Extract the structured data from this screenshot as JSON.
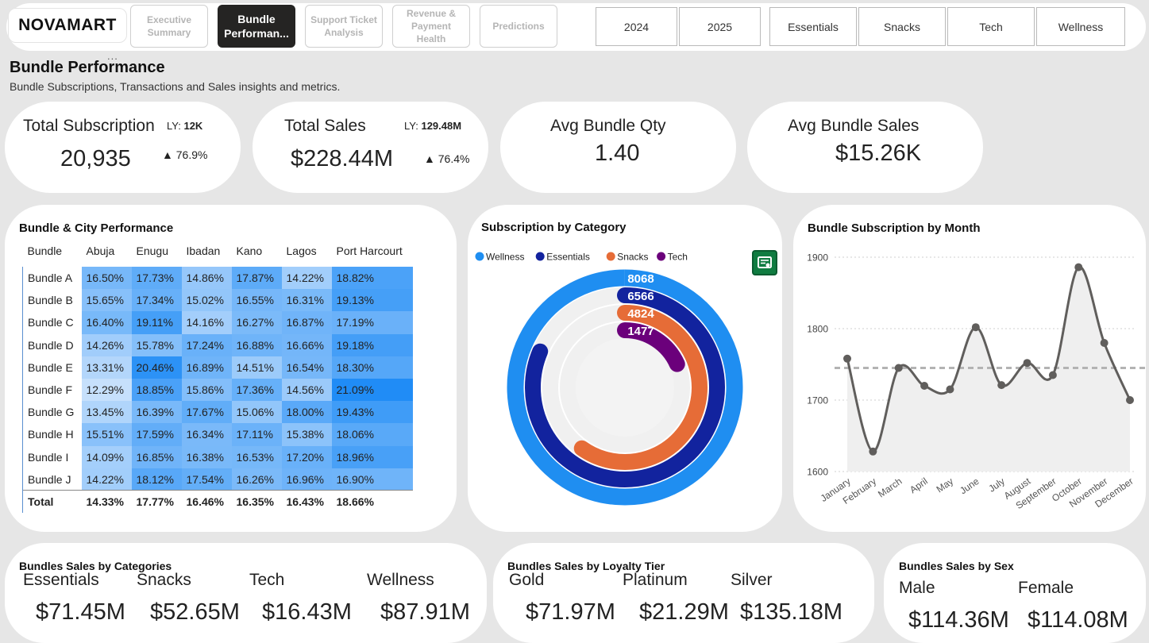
{
  "brand": "NOVAMART",
  "nav": [
    {
      "label": "Executive Summary",
      "active": false
    },
    {
      "label": "Bundle Performan...",
      "active": true
    },
    {
      "label": "Support Ticket Analysis",
      "active": false
    },
    {
      "label": "Revenue & Payment Health",
      "active": false
    },
    {
      "label": "Predictions",
      "active": false
    }
  ],
  "filters": {
    "years": [
      "2024",
      "2025"
    ],
    "categories": [
      "Essentials",
      "Snacks",
      "Tech",
      "Wellness"
    ]
  },
  "page": {
    "more": "...",
    "title": "Bundle Performance",
    "subtitle": "Bundle Subscriptions, Transactions and Sales insights and metrics."
  },
  "kpis": {
    "subscription": {
      "label": "Total Subscription",
      "value": "20,935",
      "ly_label": "LY:",
      "ly_value": "12K",
      "change": "▲ 76.9%"
    },
    "sales": {
      "label": "Total Sales",
      "value": "$228.44M",
      "ly_label": "LY:",
      "ly_value": "129.48M",
      "change": "▲ 76.4%"
    },
    "avg_qty": {
      "label": "Avg Bundle Qty",
      "value": "1.40"
    },
    "avg_sales": {
      "label": "Avg Bundle Sales",
      "value": "$15.26K"
    }
  },
  "matrix": {
    "title": "Bundle & City Performance",
    "columns": [
      "Bundle",
      "Abuja",
      "Enugu",
      "Ibadan",
      "Kano",
      "Lagos",
      "Port Harcourt"
    ],
    "rows": [
      {
        "label": "Bundle A",
        "values": [
          "16.50%",
          "17.73%",
          "14.86%",
          "17.87%",
          "14.22%",
          "18.82%"
        ],
        "shares": [
          16.5,
          17.73,
          14.86,
          17.87,
          14.22,
          18.82
        ]
      },
      {
        "label": "Bundle B",
        "values": [
          "15.65%",
          "17.34%",
          "15.02%",
          "16.55%",
          "16.31%",
          "19.13%"
        ],
        "shares": [
          15.65,
          17.34,
          15.02,
          16.55,
          16.31,
          19.13
        ]
      },
      {
        "label": "Bundle C",
        "values": [
          "16.40%",
          "19.11%",
          "14.16%",
          "16.27%",
          "16.87%",
          "17.19%"
        ],
        "shares": [
          16.4,
          19.11,
          14.16,
          16.27,
          16.87,
          17.19
        ]
      },
      {
        "label": "Bundle D",
        "values": [
          "14.26%",
          "15.78%",
          "17.24%",
          "16.88%",
          "16.66%",
          "19.18%"
        ],
        "shares": [
          14.26,
          15.78,
          17.24,
          16.88,
          16.66,
          19.18
        ]
      },
      {
        "label": "Bundle E",
        "values": [
          "13.31%",
          "20.46%",
          "16.89%",
          "14.51%",
          "16.54%",
          "18.30%"
        ],
        "shares": [
          13.31,
          20.46,
          16.89,
          14.51,
          16.54,
          18.3
        ]
      },
      {
        "label": "Bundle F",
        "values": [
          "12.29%",
          "18.85%",
          "15.86%",
          "17.36%",
          "14.56%",
          "21.09%"
        ],
        "shares": [
          12.29,
          18.85,
          15.86,
          17.36,
          14.56,
          21.09
        ]
      },
      {
        "label": "Bundle G",
        "values": [
          "13.45%",
          "16.39%",
          "17.67%",
          "15.06%",
          "18.00%",
          "19.43%"
        ],
        "shares": [
          13.45,
          16.39,
          17.67,
          15.06,
          18.0,
          19.43
        ]
      },
      {
        "label": "Bundle H",
        "values": [
          "15.51%",
          "17.59%",
          "16.34%",
          "17.11%",
          "15.38%",
          "18.06%"
        ],
        "shares": [
          15.51,
          17.59,
          16.34,
          17.11,
          15.38,
          18.06
        ]
      },
      {
        "label": "Bundle I",
        "values": [
          "14.09%",
          "16.85%",
          "16.38%",
          "16.53%",
          "17.20%",
          "18.96%"
        ],
        "shares": [
          14.09,
          16.85,
          16.38,
          16.53,
          17.2,
          18.96
        ]
      },
      {
        "label": "Bundle J",
        "values": [
          "14.22%",
          "18.12%",
          "17.54%",
          "16.26%",
          "16.96%",
          "16.90%"
        ],
        "shares": [
          14.22,
          18.12,
          17.54,
          16.26,
          16.96,
          16.9
        ]
      }
    ],
    "total": {
      "label": "Total",
      "values": [
        "14.33%",
        "17.77%",
        "16.46%",
        "16.35%",
        "16.43%",
        "18.66%"
      ]
    }
  },
  "chart_data": [
    {
      "type": "radial-bar",
      "title": "Subscription by Category",
      "series": [
        {
          "name": "Wellness",
          "value": 8068,
          "color": "#1f8ef1"
        },
        {
          "name": "Essentials",
          "value": 6566,
          "color": "#12239e"
        },
        {
          "name": "Snacks",
          "value": 4824,
          "color": "#e66c37"
        },
        {
          "name": "Tech",
          "value": 1477,
          "color": "#6b007b"
        }
      ],
      "legend": "top-left"
    },
    {
      "type": "line",
      "title": "Bundle Subscription by Month",
      "categories": [
        "January",
        "February",
        "March",
        "April",
        "May",
        "June",
        "July",
        "August",
        "September",
        "October",
        "November",
        "December"
      ],
      "values": [
        1758,
        1628,
        1745,
        1720,
        1715,
        1802,
        1721,
        1752,
        1735,
        1886,
        1780,
        1700
      ],
      "average": 1745,
      "ylim": [
        1600,
        1900
      ],
      "yticks": [
        "1600",
        "1700",
        "1800",
        "1900"
      ],
      "color": "#605e5c",
      "grid": true
    }
  ],
  "bottom": {
    "categories": {
      "title": "Bundles Sales by Categories",
      "items": [
        {
          "label": "Essentials",
          "value": "$71.45M"
        },
        {
          "label": "Snacks",
          "value": "$52.65M"
        },
        {
          "label": "Tech",
          "value": "$16.43M"
        },
        {
          "label": "Wellness",
          "value": "$87.91M"
        }
      ]
    },
    "loyalty": {
      "title": "Bundles Sales by Loyalty Tier",
      "items": [
        {
          "label": "Gold",
          "value": "$71.97M"
        },
        {
          "label": "Platinum",
          "value": "$21.29M"
        },
        {
          "label": "Silver",
          "value": "$135.18M"
        }
      ]
    },
    "sex": {
      "title": "Bundles Sales by Sex",
      "items": [
        {
          "label": "Male",
          "value": "$114.36M"
        },
        {
          "label": "Female",
          "value": "$114.08M"
        }
      ]
    }
  }
}
